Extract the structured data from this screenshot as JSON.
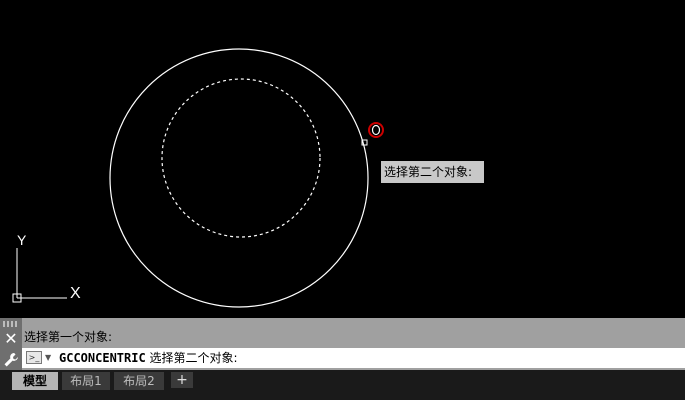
{
  "canvas": {
    "background": "#000000",
    "axis_x_label": "X",
    "axis_y_label": "Y",
    "tooltip": "选择第二个对象:",
    "snap_marker_color": "#cc0000"
  },
  "command_line": {
    "history": "选择第一个对象:",
    "command_name": "GCCONCENTRIC",
    "prompt": "选择第二个对象:",
    "prompt_icon": ">_"
  },
  "tabs": [
    {
      "label": "模型",
      "active": true
    },
    {
      "label": "布局1",
      "active": false
    },
    {
      "label": "布局2",
      "active": false
    }
  ],
  "add_tab": "+"
}
